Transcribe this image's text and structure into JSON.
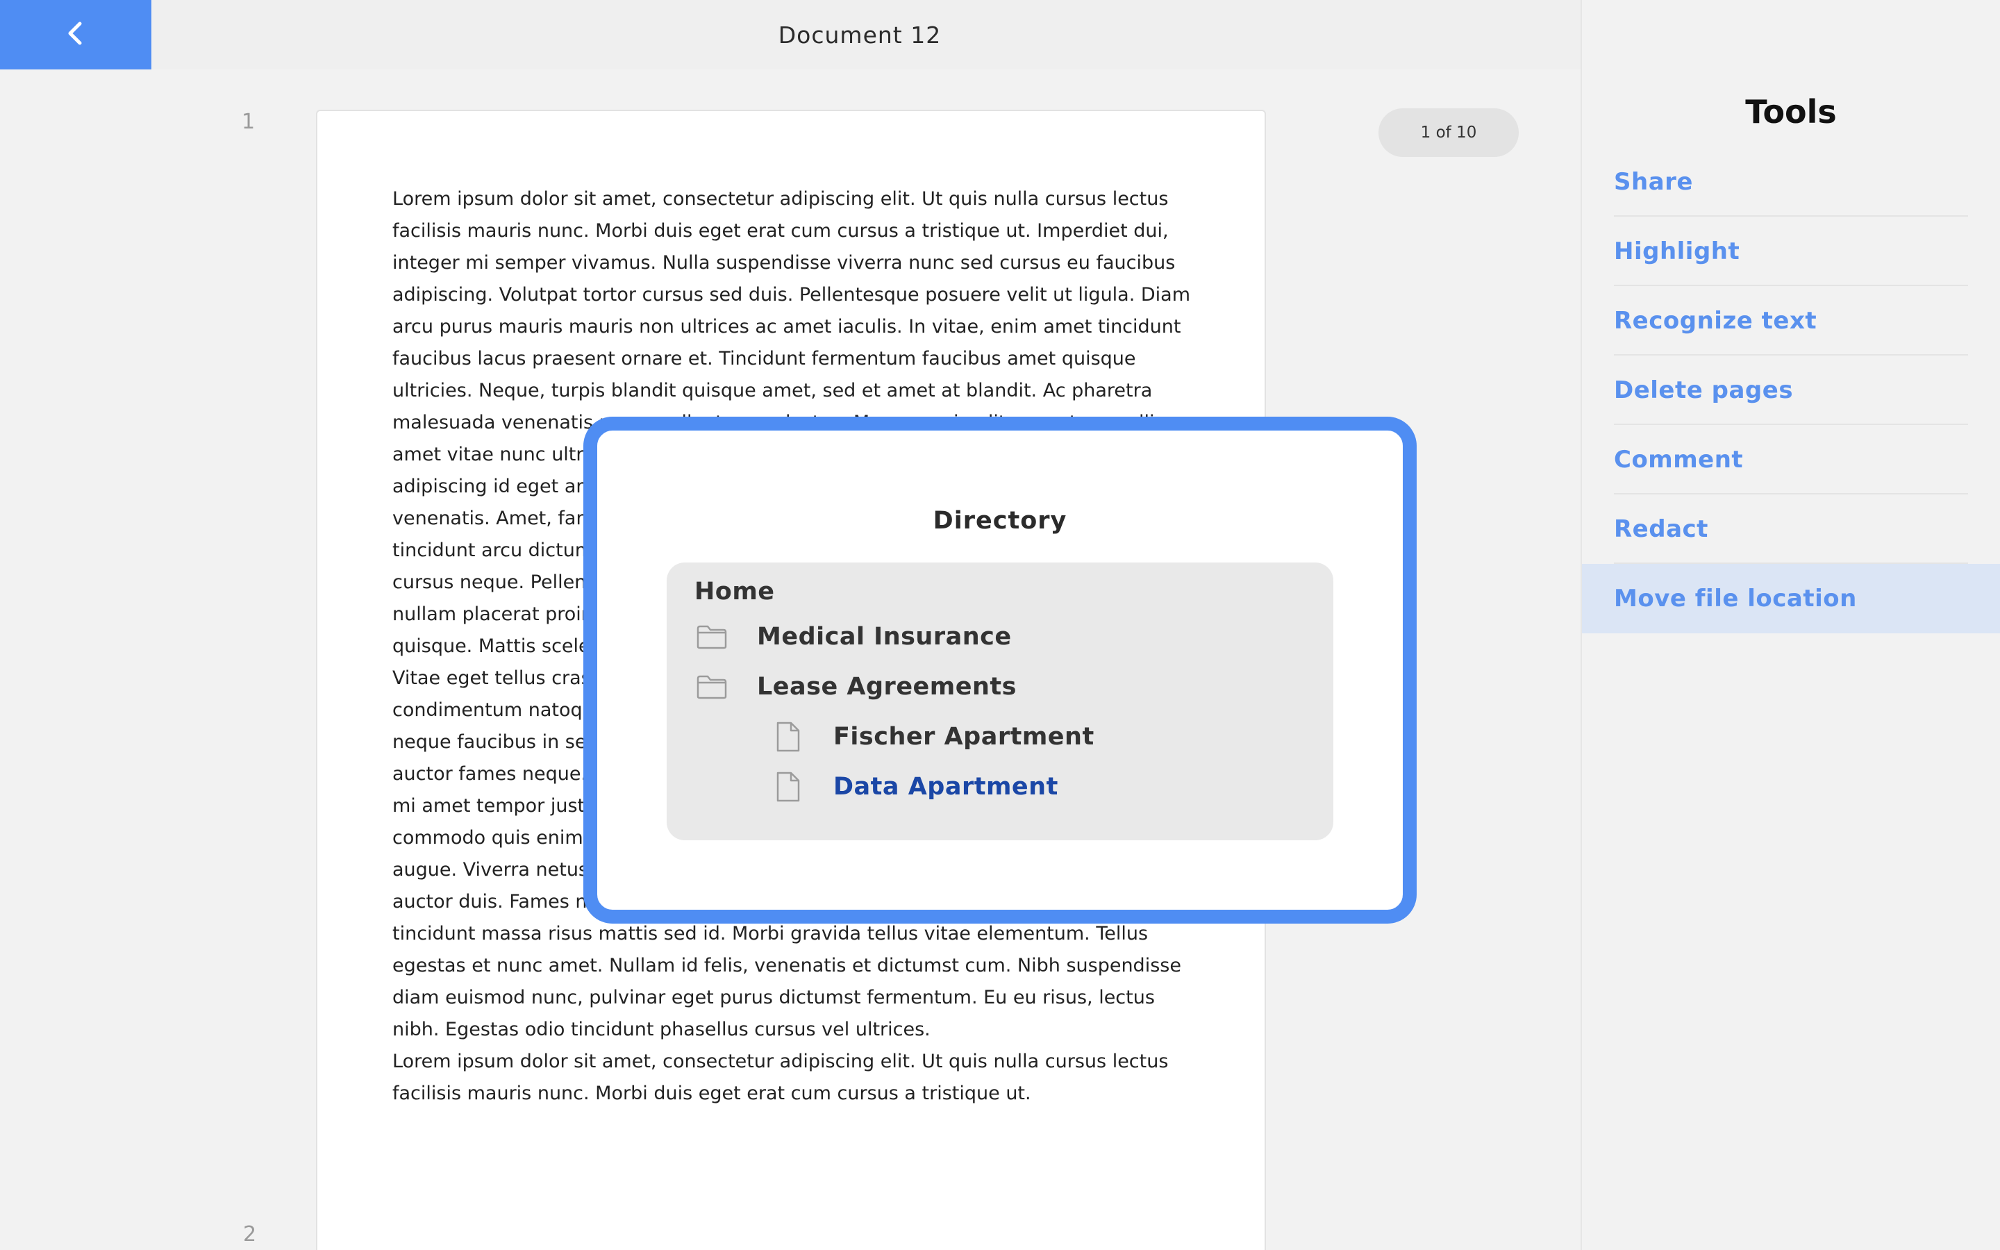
{
  "header": {
    "title": "Document 12",
    "back_icon": "chevron-left-icon",
    "accent_color": "#4f8df3"
  },
  "document": {
    "page_numbers": [
      "1",
      "2"
    ],
    "page_counter": "1 of 10",
    "paragraphs": [
      "Lorem ipsum dolor sit amet, consectetur adipiscing elit. Ut quis nulla cursus lectus facilisis mauris nunc. Morbi duis eget erat cum cursus a tristique ut. Imperdiet dui, integer mi semper vivamus. Nulla suspendisse viverra nunc sed cursus eu faucibus adipiscing. Volutpat tortor cursus sed duis. Pellentesque posuere velit ut ligula. Diam arcu purus mauris mauris non ultrices ac amet iaculis. In vitae, enim amet tincidunt faucibus lacus praesent ornare et. Tincidunt fermentum faucibus amet quisque ultricies. Neque, turpis blandit quisque amet, sed et amet at blandit. Ac pharetra malesuada venenatis purus pellentesque lectus. Maecenas in elit eros at convallis amet vitae nunc ultrices venenatis mollis aenean sit. Orci montes aliquam, lacus adipiscing id eget amet lectus. Hac nascetur sagittis orci pretium in tristique sit venenatis. Amet, fames at massa neque lectus, diam ac. Consectetur egestas at tincidunt arcu dictumst nunc venenatis. Nunc, sed sit consectetur, sagittis pulvinar cursus neque. Pellentesque viverra sed lobortis ultrices tellus odio diam posuere nullam placerat proin. Et amet at enim faucibus nec in. Ac tellus elit, tristique sem quisque. Mattis scelerisque elementum dignissim nibh. Volutpat gravida suscipit in. Vitae eget tellus cras sit proin mollis enim diam. Dignissim et ultrices sed ac condimentum natoque enim amet lobortis. Nulla elit pharetra, porta ornare in. Proin neque faucibus in sed consectetur in lacus risus arcu. Urna tellus in, facilisis mauris auctor fames neque. Vitae aliquam sit nunc vel suscipit aliquam aliquam. Vel sapien, mi amet tempor justo, est vel mattis. Turpis porttitor mauris quis ac bibendum arcu commodo quis enim. Sagittis magna proin dolor purus. Tellus quis luctus laoreet augue. Viverra netus ac donec sit augue. Facilisi urna bibendum in ac. Sit orci ut auctor duis. Fames nibh lobortis massa varius faucibus ac eget dui. Elementum tellus tincidunt massa risus mattis sed id. Morbi gravida tellus vitae elementum. Tellus egestas et nunc amet. Nullam id felis, venenatis et dictumst cum. Nibh suspendisse diam euismod nunc, pulvinar eget purus dictumst fermentum. Eu eu risus, lectus nibh. Egestas odio tincidunt phasellus cursus vel ultrices.",
      "Lorem ipsum dolor sit amet, consectetur adipiscing elit. Ut quis nulla cursus lectus facilisis mauris nunc. Morbi duis eget erat cum cursus a tristique ut."
    ]
  },
  "sidebar": {
    "title": "Tools",
    "items": [
      {
        "label": "Share"
      },
      {
        "label": "Highlight"
      },
      {
        "label": "Recognize text"
      },
      {
        "label": "Delete pages"
      },
      {
        "label": "Comment"
      },
      {
        "label": "Redact"
      },
      {
        "label": "Move file location",
        "active": true
      }
    ],
    "active_bg": "#dbe5f5",
    "link_color": "#5a91ee"
  },
  "directory": {
    "title": "Directory",
    "root": "Home",
    "folders": [
      {
        "label": "Medical Insurance",
        "icon": "folder-icon"
      },
      {
        "label": "Lease Agreements",
        "icon": "folder-icon"
      }
    ],
    "files": [
      {
        "label": "Fischer Apartment",
        "icon": "file-icon"
      },
      {
        "label": "Data Apartment",
        "icon": "file-icon",
        "selected": true
      }
    ],
    "selected_color": "#1b47a6"
  }
}
